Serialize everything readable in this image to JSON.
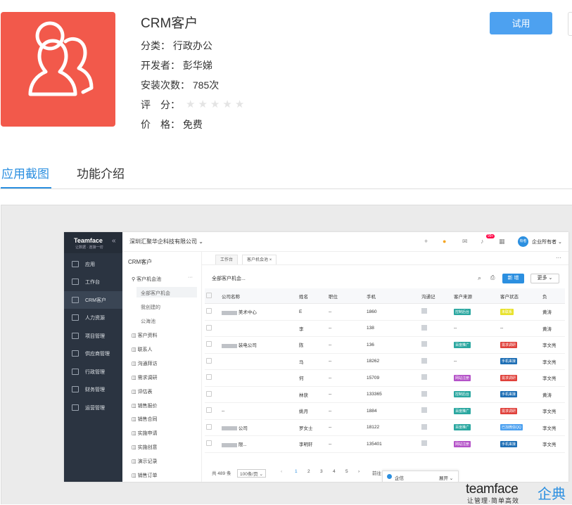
{
  "app": {
    "title": "CRM客户",
    "category_label": "分类：",
    "category": "行政办公",
    "developer_label": "开发者：",
    "developer": "彭华娣",
    "installs_label": "安装次数：",
    "installs": "785次",
    "rating_label": "评　分：",
    "rating_stars": 0,
    "rating_max": 5,
    "price_label": "价　格：",
    "price": "免费",
    "try_button": "试用",
    "icon": "users-icon",
    "icon_color": "#f2594b"
  },
  "tabs": [
    {
      "label": "应用截图",
      "active": true
    },
    {
      "label": "功能介绍",
      "active": false
    }
  ],
  "screenshot": {
    "brand": "Teamface",
    "brand_slogan": "让数据 · 连接一切",
    "collapse_icon": "double-chevron-left-icon",
    "company": "深圳汇聚华企科技有限公司 ⌄",
    "user": "企业所有者 ⌄",
    "avatar": "有者",
    "badge": "99+",
    "sidebar": [
      {
        "label": "应用",
        "icon": "grid-icon"
      },
      {
        "label": "工作台",
        "icon": "monitor-icon"
      },
      {
        "label": "CRM客户",
        "icon": "users-icon",
        "active": true
      },
      {
        "label": "人力资源",
        "icon": "users-icon"
      },
      {
        "label": "项目管理",
        "icon": "list-icon"
      },
      {
        "label": "供应商管理",
        "icon": "list-icon"
      },
      {
        "label": "行政管理",
        "icon": "person-icon"
      },
      {
        "label": "财务管理",
        "icon": "wallet-icon"
      },
      {
        "label": "运营管理",
        "icon": "calendar-icon"
      }
    ],
    "module_title": "CRM客户",
    "module_menu": {
      "pool": "客户机会池",
      "pool_subs": [
        "全部客户机会",
        "我创建的",
        "公海池"
      ],
      "items": [
        "客户资料",
        "联系人",
        "沟通拜访",
        "需求调研",
        "评估表",
        "销售报价",
        "销售合同",
        "实施申请",
        "实施创意",
        "演示记录",
        "销售订单"
      ]
    },
    "tabs": [
      "工作台",
      "客户机会池"
    ],
    "list_title": "全部客户机会...",
    "new_button": "新 增",
    "more_button": "更多 ⌄",
    "columns": [
      "公司名称",
      "姓名",
      "职位",
      "手机",
      "沟通记",
      "客户来源",
      "客户状态",
      "负"
    ],
    "rows": [
      {
        "company": "美术中心",
        "name": "E",
        "position": "--",
        "phone": "1860",
        "source": "控制后台",
        "source_color": "#2aa7a0",
        "status": "未联系",
        "status_color": "#e8e22c",
        "owner": "黄涛"
      },
      {
        "company": "",
        "name": "李",
        "position": "--",
        "phone": "138",
        "source": "--",
        "source_color": "",
        "status": "--",
        "status_color": "",
        "owner": "黄涛"
      },
      {
        "company": "装电公司",
        "name": "陈",
        "position": "--",
        "phone": "136",
        "source": "百度推广",
        "source_color": "#2aa7a0",
        "status": "需求调研",
        "status_color": "#e0413b",
        "owner": "李文亮"
      },
      {
        "company": "",
        "name": "马",
        "position": "--",
        "phone": "18262",
        "source": "--",
        "source_color": "",
        "status": "手机来接",
        "status_color": "#1f6fb5",
        "owner": "李文亮"
      },
      {
        "company": "",
        "name": "何",
        "position": "--",
        "phone": "15709",
        "source": "网站注册",
        "source_color": "#b452c8",
        "status": "需求调研",
        "status_color": "#e0413b",
        "owner": "李文亮"
      },
      {
        "company": "",
        "name": "林获",
        "position": "--",
        "phone": "133365",
        "source": "控制后台",
        "source_color": "#2aa7a0",
        "status": "手机来接",
        "status_color": "#1f6fb5",
        "owner": "黄涛"
      },
      {
        "company": "--",
        "name": "姚月",
        "position": "--",
        "phone": "1884",
        "source": "百度推广",
        "source_color": "#2aa7a0",
        "status": "需求调研",
        "status_color": "#e0413b",
        "owner": "李文亮"
      },
      {
        "company": "公司",
        "name": "罗女士",
        "position": "--",
        "phone": "18122",
        "source": "百度推广",
        "source_color": "#2aa7a0",
        "status": "已加微信QQ",
        "status_color": "#4da1f0",
        "owner": "李文亮"
      },
      {
        "company": "限...",
        "name": "李明轩",
        "position": "--",
        "phone": "135401",
        "source": "网站注册",
        "source_color": "#b452c8",
        "status": "手机来接",
        "status_color": "#1f6fb5",
        "owner": "李文亮"
      }
    ],
    "pager": {
      "total": "共 489 条",
      "page_size": "100条/页",
      "pages": [
        "1",
        "2",
        "3",
        "4",
        "5"
      ],
      "goto": "前往"
    },
    "chat": {
      "label": "企信",
      "expand": "展开"
    }
  },
  "watermark": {
    "brand": "teamface",
    "brand_cn": "企典",
    "slogan": "让管理·简单高效"
  }
}
